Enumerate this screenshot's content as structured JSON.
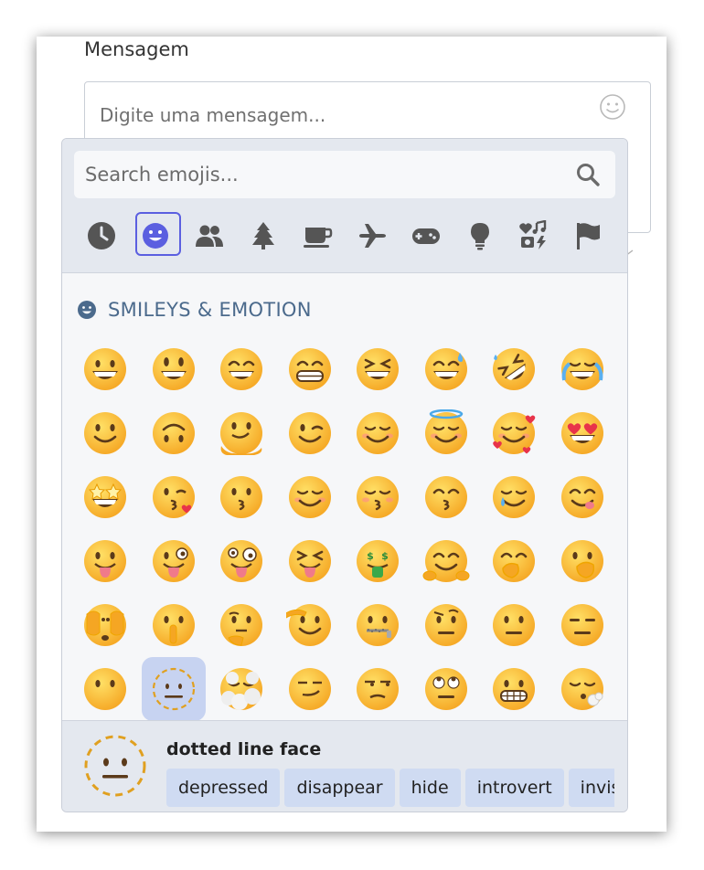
{
  "form": {
    "label": "Mensagem",
    "placeholder": "Digite uma mensagem...",
    "smiley_icon": "smiley-outline-icon"
  },
  "picker": {
    "search_placeholder": "Search emojis...",
    "categories": [
      {
        "name": "recent",
        "icon": "clock-icon"
      },
      {
        "name": "smileys",
        "icon": "smiley-icon",
        "active": true
      },
      {
        "name": "people",
        "icon": "people-icon"
      },
      {
        "name": "nature",
        "icon": "tree-icon"
      },
      {
        "name": "food",
        "icon": "coffee-icon"
      },
      {
        "name": "travel",
        "icon": "airplane-icon"
      },
      {
        "name": "activities",
        "icon": "gamepad-icon"
      },
      {
        "name": "objects",
        "icon": "lightbulb-icon"
      },
      {
        "name": "symbols",
        "icon": "symbols-icon"
      },
      {
        "name": "flags",
        "icon": "flag-icon"
      }
    ],
    "section_title": "SMILEYS & EMOTION",
    "emojis": [
      [
        "grinning",
        "smiley",
        "smile",
        "grin",
        "laughing",
        "sweat-smile",
        "rofl",
        "joy"
      ],
      [
        "slight-smile",
        "upside-down",
        "melting",
        "wink",
        "blush",
        "innocent",
        "smiling-hearts",
        "heart-eyes"
      ],
      [
        "star-struck",
        "kissing-heart",
        "kissing",
        "relaxed",
        "kissing-closed-eyes",
        "kissing-smiling-eyes",
        "smiling-tear",
        "yum"
      ],
      [
        "tongue",
        "winking-tongue",
        "zany",
        "squinting-tongue",
        "money-mouth",
        "hugging",
        "hand-over-mouth",
        "open-eyes-hand-over-mouth"
      ],
      [
        "peeking",
        "shushing",
        "thinking",
        "saluting",
        "zipper-mouth",
        "raised-eyebrow",
        "neutral",
        "expressionless"
      ],
      [
        "no-mouth",
        "dotted-line",
        "face-in-clouds",
        "smirk",
        "unamused",
        "eye-roll",
        "grimacing",
        "exhaling"
      ]
    ],
    "selected": {
      "row": 5,
      "col": 1
    },
    "footer": {
      "name": "dotted line face",
      "tags": [
        "depressed",
        "disappear",
        "hide",
        "introvert",
        "invisi"
      ]
    },
    "colors": {
      "accent": "#5b5fe0",
      "section": "#4b6a8c",
      "selected_bg": "#c7d3f1",
      "emoji_yellow": "#ffc83d"
    }
  }
}
